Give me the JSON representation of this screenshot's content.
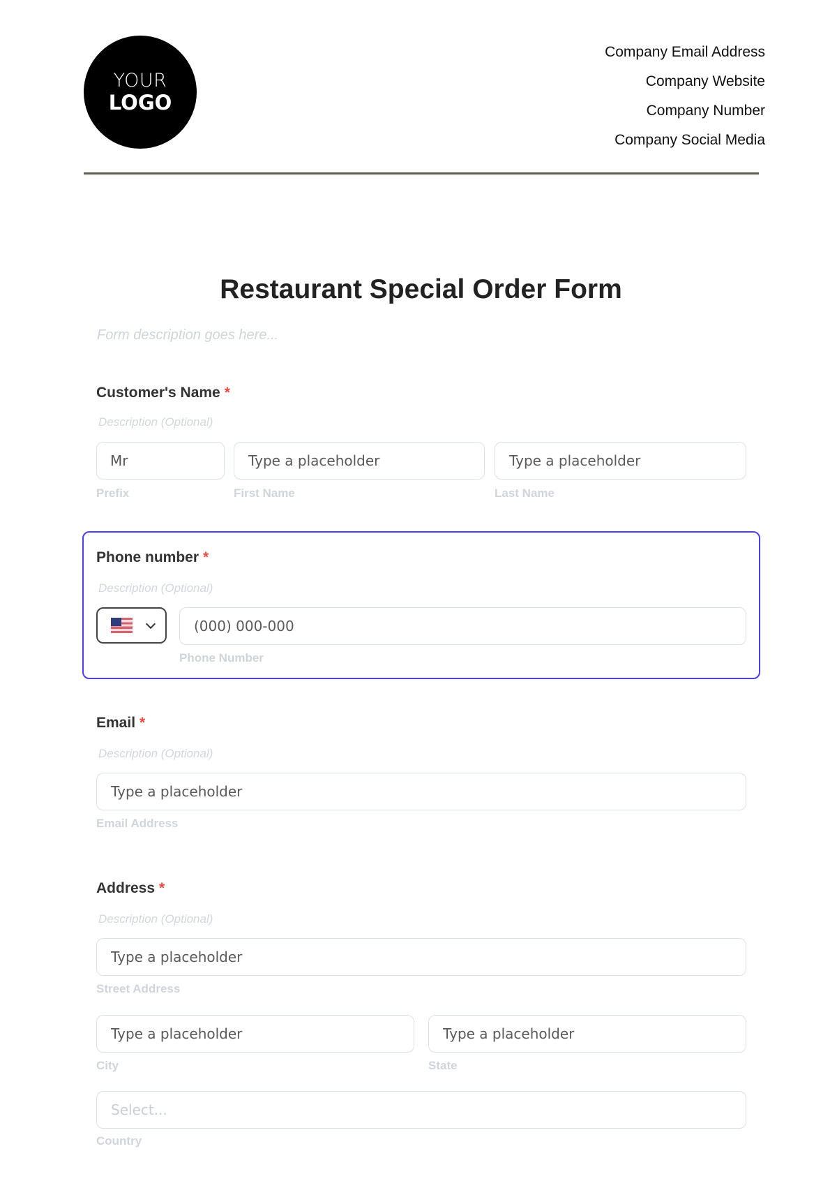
{
  "header": {
    "logo": {
      "line1": "YOUR",
      "line2": "LOGO"
    },
    "contact": [
      "Company Email Address",
      "Company Website",
      "Company Number",
      "Company Social Media"
    ]
  },
  "form": {
    "title": "Restaurant Special Order Form",
    "description_placeholder": "Form description goes here...",
    "required_marker": "*",
    "fields": {
      "customer_name": {
        "label": "Customer's Name",
        "description": "Description (Optional)",
        "prefix": {
          "value": "Mr",
          "sublabel": "Prefix"
        },
        "first_name": {
          "placeholder": "Type a placeholder",
          "sublabel": "First Name"
        },
        "last_name": {
          "placeholder": "Type a placeholder",
          "sublabel": "Last Name"
        }
      },
      "phone": {
        "label": "Phone number",
        "description": "Description (Optional)",
        "country_flag": "us-flag-icon",
        "number": {
          "placeholder": "(000) 000-000",
          "sublabel": "Phone Number"
        }
      },
      "email": {
        "label": "Email",
        "description": "Description (Optional)",
        "input": {
          "placeholder": "Type a placeholder",
          "sublabel": "Email Address"
        }
      },
      "address": {
        "label": "Address",
        "description": "Description (Optional)",
        "street": {
          "placeholder": "Type a placeholder",
          "sublabel": "Street Address"
        },
        "city": {
          "placeholder": "Type a placeholder",
          "sublabel": "City"
        },
        "state": {
          "placeholder": "Type a placeholder",
          "sublabel": "State"
        },
        "country": {
          "placeholder": "Select...",
          "sublabel": "Country"
        }
      }
    }
  },
  "colors": {
    "focus_border": "#4a3df5",
    "required": "#f0473e",
    "divider": "#5c5c4f"
  }
}
